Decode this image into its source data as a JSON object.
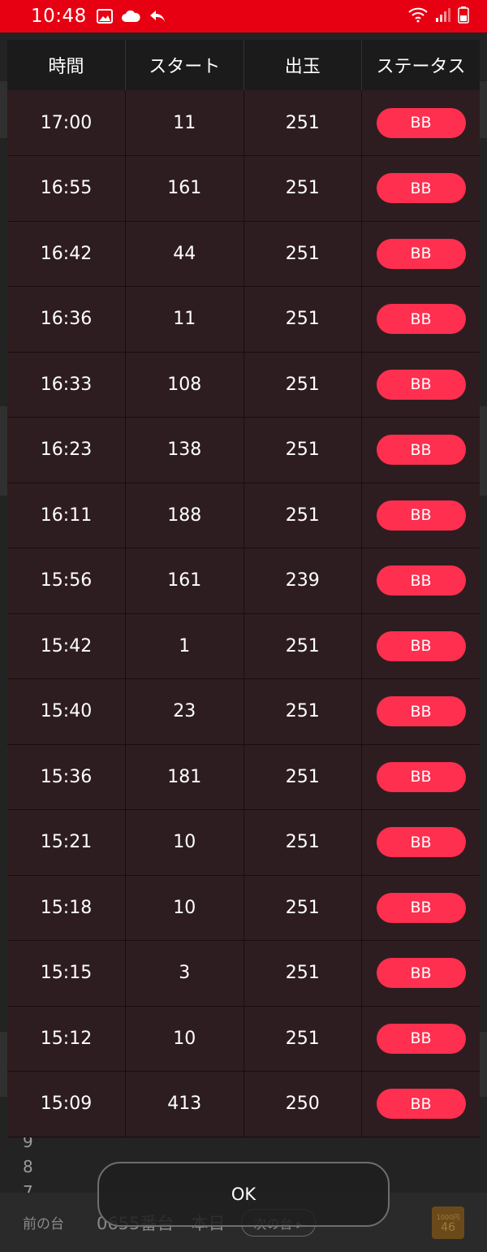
{
  "status_bar": {
    "time": "10:48",
    "left_icons": [
      "image-icon",
      "cloud-icon",
      "reply-icon"
    ],
    "right_icons": [
      "wifi-icon",
      "signal-icon",
      "battery-icon"
    ]
  },
  "background": {
    "numbers": [
      "9",
      "8",
      "7"
    ],
    "prev_label": "前の台",
    "machine_label": "0655番台　本日",
    "next_label": "次の台",
    "badge_top": "1000円",
    "badge_value": "46"
  },
  "table": {
    "headers": [
      "時間",
      "スタート",
      "出玉",
      "ステータス"
    ],
    "rows": [
      {
        "time": "17:00",
        "start": "11",
        "payout": "251",
        "status": "BB"
      },
      {
        "time": "16:55",
        "start": "161",
        "payout": "251",
        "status": "BB"
      },
      {
        "time": "16:42",
        "start": "44",
        "payout": "251",
        "status": "BB"
      },
      {
        "time": "16:36",
        "start": "11",
        "payout": "251",
        "status": "BB"
      },
      {
        "time": "16:33",
        "start": "108",
        "payout": "251",
        "status": "BB"
      },
      {
        "time": "16:23",
        "start": "138",
        "payout": "251",
        "status": "BB"
      },
      {
        "time": "16:11",
        "start": "188",
        "payout": "251",
        "status": "BB"
      },
      {
        "time": "15:56",
        "start": "161",
        "payout": "239",
        "status": "BB"
      },
      {
        "time": "15:42",
        "start": "1",
        "payout": "251",
        "status": "BB"
      },
      {
        "time": "15:40",
        "start": "23",
        "payout": "251",
        "status": "BB"
      },
      {
        "time": "15:36",
        "start": "181",
        "payout": "251",
        "status": "BB"
      },
      {
        "time": "15:21",
        "start": "10",
        "payout": "251",
        "status": "BB"
      },
      {
        "time": "15:18",
        "start": "10",
        "payout": "251",
        "status": "BB"
      },
      {
        "time": "15:15",
        "start": "3",
        "payout": "251",
        "status": "BB"
      },
      {
        "time": "15:12",
        "start": "10",
        "payout": "251",
        "status": "BB"
      },
      {
        "time": "15:09",
        "start": "413",
        "payout": "250",
        "status": "BB"
      }
    ]
  },
  "ok_label": "OK",
  "colors": {
    "status_bar": "#e60012",
    "dialog_bg": "#2e1d20",
    "header_bg": "#1b1b1b",
    "badge": "#ff2f4f"
  }
}
